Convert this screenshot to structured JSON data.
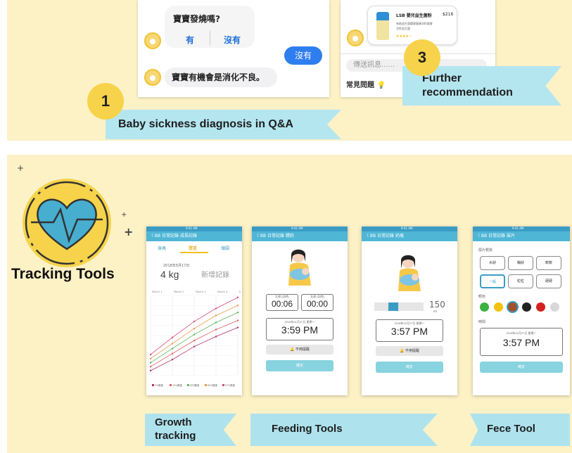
{
  "top": {
    "chat": {
      "q1": "寶寶發燒嗎?",
      "yes": "有",
      "no": "沒有",
      "reply": "沒有",
      "a1": "寶寶有機會是消化不良。"
    },
    "product": {
      "name": "LSB 嬰兒益生菌粉",
      "price": "$216",
      "desc1": "有助益生菌腸胃健康380發酵",
      "desc2": "活性益生菌",
      "stars": "★★★★☆",
      "input_placeholder": "傳送訊息......",
      "faq": "常見問題"
    },
    "ribbons": {
      "n1": "1",
      "qa": "Baby sickness diagnosis in Q&A",
      "n3": "3",
      "further1": "Further",
      "further2": "recommendation"
    }
  },
  "bottom": {
    "title": "Tracking Tools",
    "ribbons": {
      "growth1": "Growth",
      "growth2": "tracking",
      "feeding": "Feeding Tools",
      "fece": "Fece Tool"
    },
    "s1": {
      "nav": "〈 BB 日常記錄   成長記錄",
      "tabs": [
        "身高",
        "體重",
        "頭圍"
      ],
      "date": "2018年5月17日",
      "weight": "4 kg",
      "new": "新增記錄",
      "months": [
        "Month 1",
        "Month 2",
        "Month 3",
        "Month 4",
        "Month 5"
      ],
      "legend": [
        "3%體重",
        "15%體重",
        "平均體重",
        "85%體重",
        "97%體重"
      ],
      "chart_data": {
        "type": "line",
        "categories": [
          "Month 1",
          "Month 2",
          "Month 3",
          "Month 4",
          "Month 5"
        ],
        "series": [
          {
            "name": "97%體重",
            "values": [
              5.1,
              6.8,
              8.4,
              9.7,
              10.8
            ]
          },
          {
            "name": "85%體重",
            "values": [
              4.7,
              6.2,
              7.7,
              9.0,
              10.0
            ]
          },
          {
            "name": "平均體重",
            "values": [
              4.3,
              5.7,
              7.1,
              8.3,
              9.3
            ]
          },
          {
            "name": "15%體重",
            "values": [
              3.9,
              5.2,
              6.5,
              7.6,
              8.5
            ]
          },
          {
            "name": "3%體重",
            "values": [
              3.5,
              4.6,
              5.9,
              6.9,
              7.8
            ]
          }
        ],
        "ylim": [
          3,
          11
        ],
        "colors": [
          "#d44a7a",
          "#e79a4a",
          "#5cb85c",
          "#e06060",
          "#b0306a"
        ]
      }
    },
    "s2": {
      "nav": "〈 BB 日常記錄   餵奶",
      "left_label": "左邊 (計時)",
      "right_label": "右邊 (計時)",
      "left": "00:06",
      "right": "00:00",
      "date": "2018年01月27日 星期一",
      "time": "3:59 PM",
      "remind": "🔔 不用提醒",
      "confirm": "確定"
    },
    "s3": {
      "nav": "〈 BB 日常記錄   奶瓶",
      "amount": "150",
      "unit": "ml",
      "fill_fraction": 0.2,
      "date": "2018年01月27日 星期一",
      "time": "3:57 PM",
      "remind": "🔔 不用提醒",
      "confirm": "確定"
    },
    "s4": {
      "nav": "〈 BB 日常記錄   屎片",
      "shape_label": "屎片數質",
      "shapes": [
        "水狀",
        "糊狀",
        "軟軟",
        "一般",
        "粒粒",
        "硬硬"
      ],
      "color_label": "顏色",
      "colors": [
        "#3cb043",
        "#f2c20f",
        "#a0522d",
        "#222222",
        "#d32020",
        "#d8d8d8"
      ],
      "time_label": "時間",
      "date": "2018年01月27日 星期一",
      "time": "3:57 PM",
      "confirm": "確定"
    },
    "statusbar": "9:41 AM"
  }
}
